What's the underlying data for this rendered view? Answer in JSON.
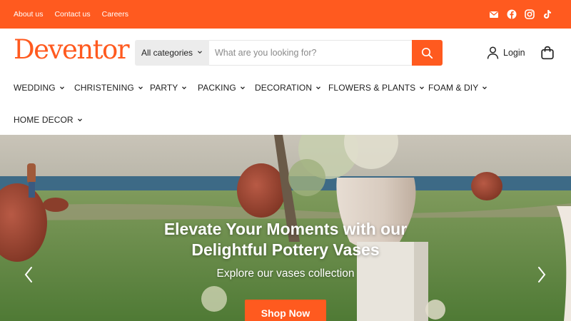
{
  "topbar": {
    "links": [
      "About us",
      "Contact us",
      "Careers"
    ],
    "social_icons": [
      "email-icon",
      "facebook-icon",
      "instagram-icon",
      "tiktok-icon"
    ]
  },
  "header": {
    "logo_text": "Deventor",
    "category_label": "All categories",
    "search_placeholder": "What are you looking for?",
    "login_label": "Login"
  },
  "nav": {
    "items": [
      "WEDDING",
      "CHRISTENING",
      "PARTY",
      "PACKING",
      "DECORATION",
      "FLOWERS & PLANTS",
      "FOAM & DIY",
      "HOME DECOR"
    ]
  },
  "hero": {
    "title_line1": "Elevate Your Moments with our",
    "title_line2": "Delightful Pottery Vases",
    "subtitle": "Explore our vases collection",
    "cta_label": "Shop Now"
  },
  "colors": {
    "accent": "#ff5a1f",
    "search_category_bg": "#ececec"
  }
}
